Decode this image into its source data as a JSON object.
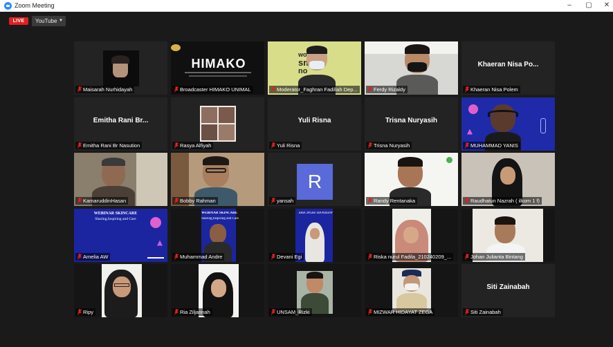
{
  "window": {
    "title": "Zoom Meeting",
    "minimize": "–",
    "maximize": "▢",
    "close": "✕"
  },
  "toolbar": {
    "live": "LIVE",
    "stream": "YouTube"
  },
  "participants": [
    {
      "name": "Maisarah Nurhidayah",
      "video": "dark-portrait"
    },
    {
      "name": "Broadcaster HIMAKO UNIMAL",
      "video": "himako-logo"
    },
    {
      "name": "Moderator_Faghran Fadillah Dep...",
      "video": "moderator",
      "active": true
    },
    {
      "name": "Ferdy Rizaldy",
      "video": "office-man"
    },
    {
      "name": "Khaeran Nisa Polem",
      "display": "Khaeran Nisa Po..."
    },
    {
      "name": "Emitha Rani Br Nasution",
      "display": "Emitha Rani Br..."
    },
    {
      "name": "Rasya Alfiyah",
      "video": "collage"
    },
    {
      "name": "Yuli Risna",
      "display": "Yuli Risna"
    },
    {
      "name": "Trisna Nuryasih",
      "display": "Trisna Nuryasih"
    },
    {
      "name": "MUHAMMAD YANIS",
      "video": "webinar-headphones"
    },
    {
      "name": "KamaruddinHasan",
      "video": "man-room"
    },
    {
      "name": "Bobby Rahman",
      "video": "glasses-man"
    },
    {
      "name": "yansah",
      "avatar": "R"
    },
    {
      "name": "Randy Rentanaka",
      "video": "young-man-white"
    },
    {
      "name": "Raudhatun Nazrah ( ilkom 1 f)",
      "video": "hijab-dark"
    },
    {
      "name": "Amelia AW",
      "video": "webinar-slide"
    },
    {
      "name": "Muhammad Andre",
      "video": "webinar-person"
    },
    {
      "name": "Devani Egi",
      "video": "webinar-hijab"
    },
    {
      "name": "Riska nurul Fadila_210240209_...",
      "video": "hijab-pink"
    },
    {
      "name": "Johan Julianta Bintang",
      "video": "man-light"
    },
    {
      "name": "Ripy",
      "video": "hijab-glasses"
    },
    {
      "name": "Ria Ziljannah",
      "video": "hijab-black"
    },
    {
      "name": "UNSAM_Rizki",
      "video": "man-batik"
    },
    {
      "name": "MIZWAR HIDAYAT ZEGA",
      "video": "uniform"
    },
    {
      "name": "Siti Zainabah",
      "display": "Siti Zainabah"
    }
  ],
  "himako": {
    "logo_text": "HIMAKO"
  },
  "moderator_bg": {
    "line1": "wo",
    "line2": "smart",
    "line3": "no"
  },
  "webinar": {
    "title": "WEBINAR SKINCARE",
    "subtitle": "Sharing,Inspiring and Care"
  },
  "colors": {
    "accent": "#c8d84a",
    "live": "#e02020",
    "avatar": "#5a6ad8"
  }
}
